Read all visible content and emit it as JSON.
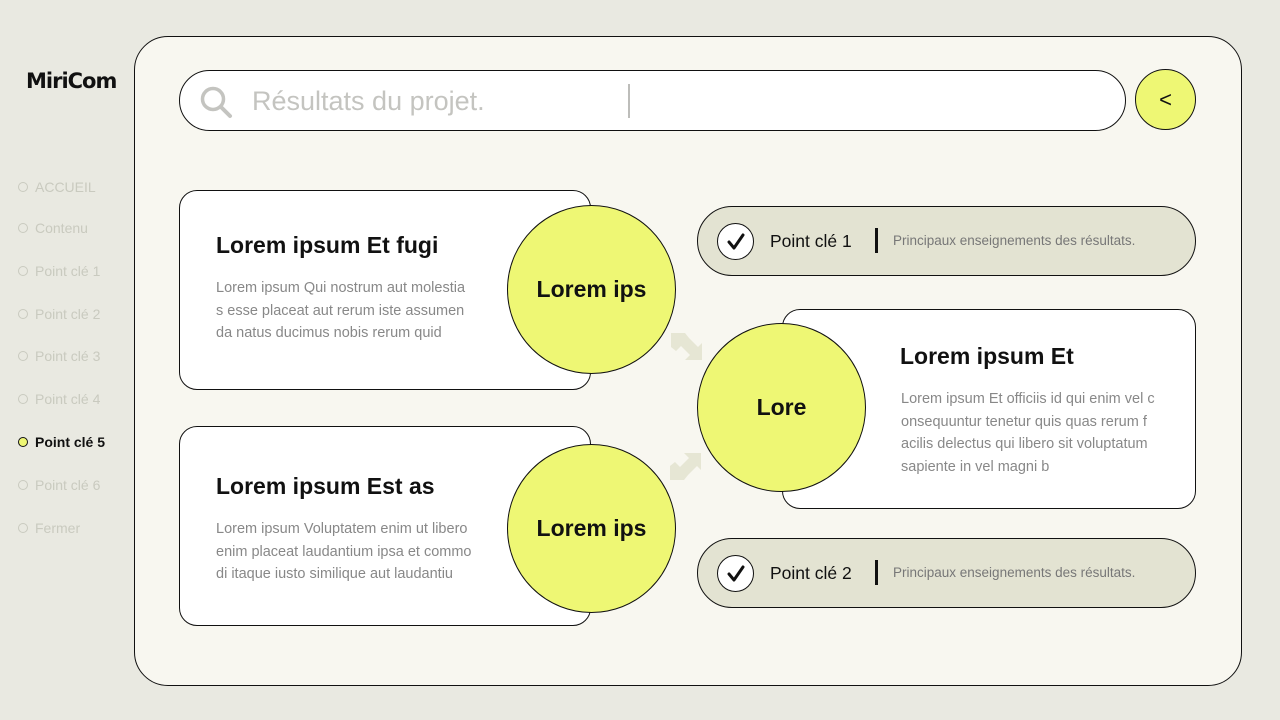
{
  "brand": {
    "logo": "MiriCom"
  },
  "nav": {
    "items": [
      {
        "label": "ACCUEIL",
        "active": false
      },
      {
        "label": "Contenu",
        "active": false
      },
      {
        "label": "Point clé 1",
        "active": false
      },
      {
        "label": "Point clé 2",
        "active": false
      },
      {
        "label": "Point clé 3",
        "active": false
      },
      {
        "label": "Point clé 4",
        "active": false
      },
      {
        "label": "Point clé 5",
        "active": true
      },
      {
        "label": "Point clé 6",
        "active": false
      },
      {
        "label": "Fermer",
        "active": false
      }
    ]
  },
  "search": {
    "placeholder": "Résultats du projet.",
    "value": ""
  },
  "back_button": {
    "label": "<"
  },
  "cards": [
    {
      "title": "Lorem ipsum Et fugi",
      "text": "Lorem ipsum Qui nostrum aut molestia s esse placeat aut rerum iste assumen da natus ducimus nobis rerum quid",
      "circle": "Lorem ips"
    },
    {
      "title": "Lorem ipsum Est as",
      "text": "Lorem ipsum Voluptatem enim ut libero enim placeat laudantium ipsa et commo di itaque iusto similique aut laudantiu",
      "circle": "Lorem ips"
    },
    {
      "title": "Lorem ipsum Et",
      "text": "Lorem ipsum Et officiis id qui enim vel c onsequuntur tenetur quis quas rerum f acilis delectus qui libero sit voluptatum sapiente in vel magni b",
      "circle": "Lore"
    }
  ],
  "keypoints": [
    {
      "label": "Point clé 1",
      "description": "Principaux enseignements des résultats.",
      "checked": true
    },
    {
      "label": "Point clé 2",
      "description": "Principaux enseignements des résultats.",
      "checked": true
    }
  ],
  "colors": {
    "accent": "#eef774",
    "background": "#e9e9e1",
    "panel": "#f8f7f0",
    "pill": "#e3e3d2",
    "muted_nav": "#c9cabf"
  },
  "icons": {
    "search": "search-icon",
    "check": "check-icon",
    "arrow": "arrow-icon"
  }
}
